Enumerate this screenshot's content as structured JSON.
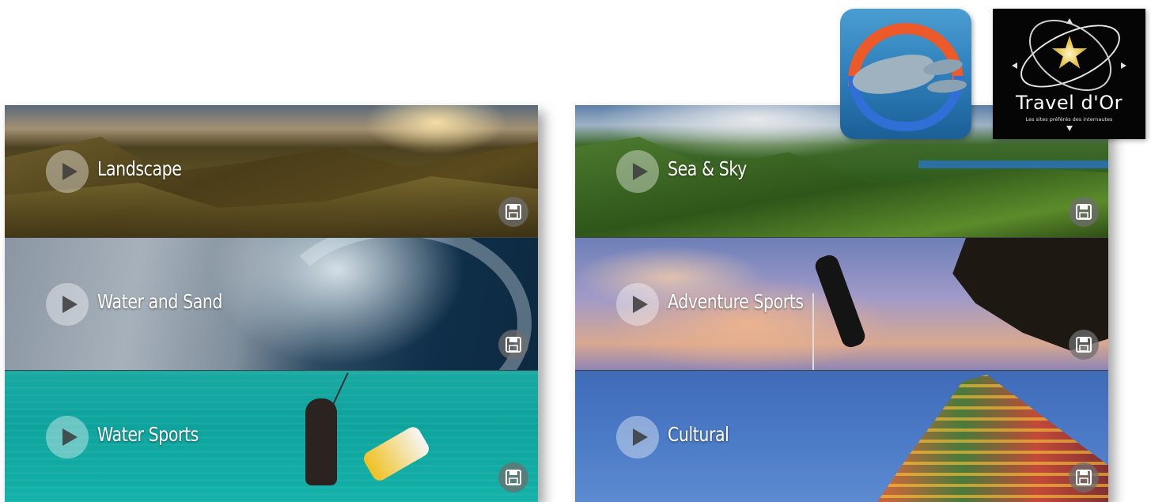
{
  "categories_left": [
    {
      "label": "Landscape",
      "theme": "landscape"
    },
    {
      "label": "Water and Sand",
      "theme": "water"
    },
    {
      "label": "Water Sports",
      "theme": "watersports"
    }
  ],
  "categories_right": [
    {
      "label": "Sea & Sky",
      "theme": "seasky"
    },
    {
      "label": "Adventure Sports",
      "theme": "adventure"
    },
    {
      "label": "Cultural",
      "theme": "cultural"
    }
  ],
  "icons": {
    "play": "play-icon",
    "save": "floppy-disk-icon"
  },
  "logos": {
    "travel_dor": {
      "brand": "Travel d'Or",
      "tagline": "Les sites préférés des internautes"
    }
  },
  "colors": {
    "label_text": "#ffffff",
    "play_circle": "rgba(255,255,255,0.38)",
    "save_circle": "#6e6e6e",
    "travel_logo_bg": "#050505"
  }
}
